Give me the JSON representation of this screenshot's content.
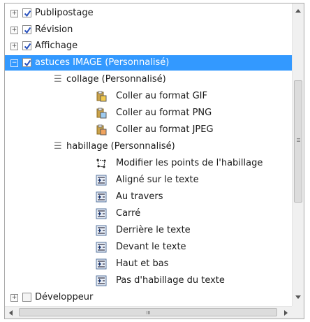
{
  "tree": {
    "items": [
      {
        "label": "Publipostage",
        "level": 0,
        "checked": true,
        "expander": "+"
      },
      {
        "label": "Révision",
        "level": 0,
        "checked": true,
        "expander": "+"
      },
      {
        "label": "Affichage",
        "level": 0,
        "checked": true,
        "expander": "+"
      },
      {
        "label": "astuces IMAGE (Personnalisé)",
        "level": 0,
        "checked": true,
        "expander": "−",
        "selected": true
      },
      {
        "label": "collage (Personnalisé)",
        "level": 1,
        "group": true
      },
      {
        "label": "Coller au format GIF",
        "level": 2,
        "icon": "paste-gif-icon"
      },
      {
        "label": "Coller au format PNG",
        "level": 2,
        "icon": "paste-png-icon"
      },
      {
        "label": "Coller au format JPEG",
        "level": 2,
        "icon": "paste-jpeg-icon"
      },
      {
        "label": "habillage (Personnalisé)",
        "level": 1,
        "group": true
      },
      {
        "label": "Modifier les points de l'habillage",
        "level": 2,
        "icon": "edit-wrap-points-icon"
      },
      {
        "label": "Aligné sur le texte",
        "level": 2,
        "icon": "wrap-inline-icon"
      },
      {
        "label": "Au travers",
        "level": 2,
        "icon": "wrap-through-icon"
      },
      {
        "label": "Carré",
        "level": 2,
        "icon": "wrap-square-icon"
      },
      {
        "label": "Derrière le texte",
        "level": 2,
        "icon": "wrap-behind-icon"
      },
      {
        "label": "Devant le texte",
        "level": 2,
        "icon": "wrap-front-icon"
      },
      {
        "label": "Haut et bas",
        "level": 2,
        "icon": "wrap-top-bottom-icon"
      },
      {
        "label": "Pas d'habillage du texte",
        "level": 2,
        "icon": "wrap-none-icon"
      },
      {
        "label": "Développeur",
        "level": 0,
        "checked": false,
        "expander": "+"
      }
    ]
  },
  "scroll": {
    "vertical_icon": "scroll-arrow-icons",
    "horizontal_icon": "scroll-arrow-icons"
  },
  "colors": {
    "selection": "#3399ff",
    "check": "#2a52be"
  }
}
